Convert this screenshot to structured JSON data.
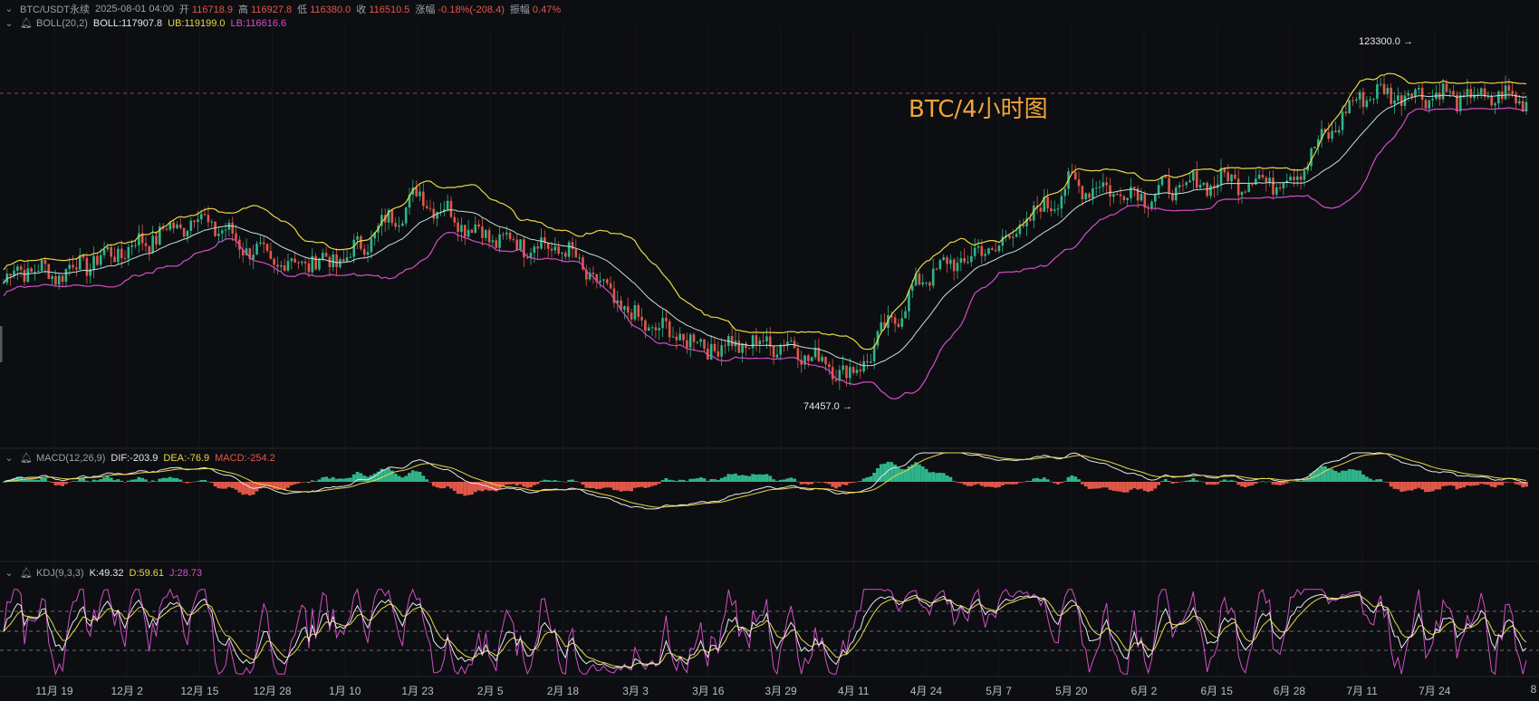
{
  "overlay_title": "BTC/4小时图",
  "header": {
    "symbol": "BTC/USDT永续",
    "datetime": "2025-08-01 04:00",
    "open_label": "开",
    "open": "116718.9",
    "high_label": "高",
    "high": "116927.8",
    "low_label": "低",
    "low": "116380.0",
    "close_label": "收",
    "close": "116510.5",
    "change_label": "涨幅",
    "change": "-0.18%(-208.4)",
    "amp_label": "振幅",
    "amp": "0.47%"
  },
  "boll": {
    "name": "BOLL(20,2)",
    "mid": "BOLL:117907.8",
    "ub": "UB:119199.0",
    "lb": "LB:116616.6"
  },
  "macd": {
    "name": "MACD(12,26,9)",
    "dif": "DIF:-203.9",
    "dea": "DEA:-76.9",
    "macd": "MACD:-254.2"
  },
  "kdj": {
    "name": "KDJ(9,3,3)",
    "k": "K:49.32",
    "d": "D:59.61",
    "j": "J:28.73"
  },
  "annotations": {
    "high_price": "123300.0",
    "low_price": "74457.0"
  },
  "x_axis": [
    "11月 19",
    "12月 2",
    "12月 15",
    "12月 28",
    "1月 10",
    "1月 23",
    "2月 5",
    "2月 18",
    "3月 3",
    "3月 16",
    "3月 29",
    "4月 11",
    "4月 24",
    "5月 7",
    "5月 20",
    "6月 2",
    "6月 15",
    "6月 28",
    "7月 11",
    "7月 24",
    "8"
  ],
  "colors": {
    "background": "#0d0e11",
    "up": "#2fb58a",
    "down": "#e0584a",
    "boll_mid": "#e6e8eb",
    "boll_ub": "#e7d84a",
    "boll_lb": "#d24fc8",
    "title": "#f3a43a"
  },
  "chart_data": {
    "type": "line",
    "title": "BTC/4小时图",
    "description_series": "approximate BTC/USDT 4h close path (data units: USDT)",
    "categories": [
      "11月 19",
      "12月 2",
      "12月 15",
      "12月 28",
      "1月 10",
      "1月 23",
      "2月 5",
      "2月 18",
      "3月 3",
      "3月 16",
      "3月 29",
      "4月 11",
      "4月 24",
      "5月 7",
      "5月 20",
      "6月 2",
      "6月 15",
      "6月 28",
      "7月 11",
      "7月 24"
    ],
    "series": [
      {
        "name": "BOLL",
        "values": [
          93000,
          96500,
          101000,
          94500,
          95000,
          104000,
          98000,
          96500,
          86500,
          83000,
          83500,
          79000,
          93000,
          97000,
          105500,
          104000,
          106000,
          106000,
          118000,
          118000
        ]
      }
    ],
    "ylim": [
      72000,
      126000
    ],
    "highlights": {
      "max": 123300.0,
      "min": 74457.0
    },
    "grid": false
  }
}
